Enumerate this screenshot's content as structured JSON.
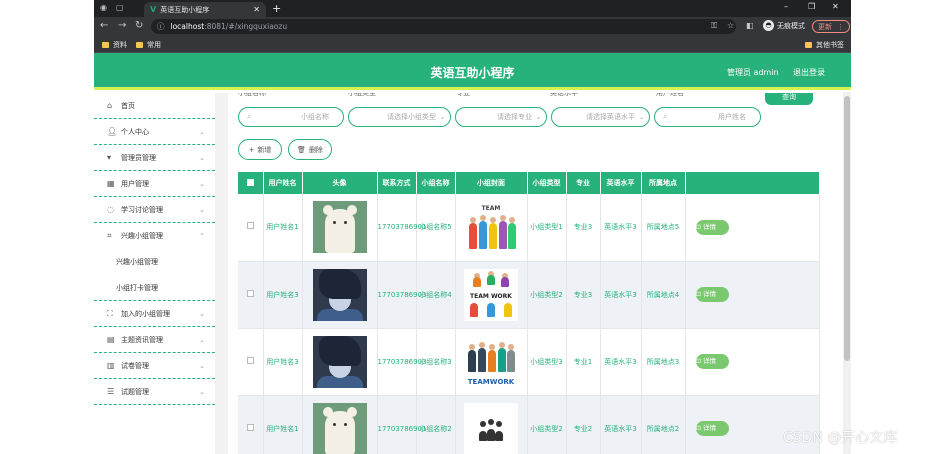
{
  "browser": {
    "tab_title": "英语互助小程序",
    "tab_favicon": "V",
    "url_host": "localhost",
    "url_path": ":8081/#/xingquxiaozu",
    "profile_label": "无痕模式",
    "update_label": "更新",
    "bookmarks": [
      "资料",
      "常用"
    ],
    "other_bookmarks": "其他书签"
  },
  "header": {
    "title": "英语互助小程序",
    "user": "管理员 admin",
    "logout": "退出登录"
  },
  "sidebar": {
    "items": [
      {
        "label": "首页",
        "icon": "home-icon"
      },
      {
        "label": "个人中心",
        "icon": "user-icon"
      },
      {
        "label": "管理员管理",
        "icon": "admin-icon"
      },
      {
        "label": "用户管理",
        "icon": "grid-icon"
      },
      {
        "label": "学习讨论管理",
        "icon": "loading-icon"
      },
      {
        "label": "兴趣小组管理",
        "icon": "crop-icon"
      },
      {
        "label": "加入的小组管理",
        "icon": "fullscreen-icon"
      },
      {
        "label": "主题资讯管理",
        "icon": "news-icon"
      },
      {
        "label": "试卷管理",
        "icon": "chart-icon"
      },
      {
        "label": "试题管理",
        "icon": "sliders-icon"
      }
    ],
    "subitems": [
      "兴趣小组管理",
      "小组打卡管理"
    ]
  },
  "search": {
    "labels": [
      "小组名称",
      "小组类型",
      "专业",
      "英语水平",
      "用户姓名"
    ],
    "placeholders": [
      "小组名称",
      "请选择小组类型",
      "请选择专业",
      "请选择英语水平",
      "用户姓名"
    ],
    "button": "查询"
  },
  "actions": {
    "add": "新增",
    "delete": "删除"
  },
  "table": {
    "columns": [
      "用户姓名",
      "头像",
      "联系方式",
      "小组名称",
      "小组封面",
      "小组类型",
      "专业",
      "英语水平",
      "所属地点"
    ],
    "detail_label": "详情",
    "rows": [
      {
        "user": "用户姓名1",
        "avatar": "bear",
        "phone": "17703786901",
        "group": "小组名称5",
        "cover": "team-hands",
        "type": "小组类型1",
        "major": "专业3",
        "level": "英语水平3",
        "place": "所属地点5"
      },
      {
        "user": "用户姓名3",
        "avatar": "anime-boy",
        "phone": "17703786903",
        "group": "小组名称4",
        "cover": "team-work",
        "type": "小组类型2",
        "major": "专业3",
        "level": "英语水平3",
        "place": "所属地点4"
      },
      {
        "user": "用户姓名3",
        "avatar": "anime-boy",
        "phone": "17703786903",
        "group": "小组名称3",
        "cover": "teamwork-office",
        "type": "小组类型3",
        "major": "专业1",
        "level": "英语水平3",
        "place": "所属地点3"
      },
      {
        "user": "用户姓名1",
        "avatar": "bear",
        "phone": "17703786901",
        "group": "小组名称2",
        "cover": "team-icon",
        "type": "小组类型2",
        "major": "专业2",
        "level": "英语水平3",
        "place": "所属地点2"
      }
    ]
  },
  "cover_text": {
    "team": "TEAM",
    "teamwork": "TEAM WORK",
    "teamwork_office": "TEAMWORK"
  },
  "watermark": "CSDN @开心文库",
  "colors": {
    "accent": "#27b17b",
    "header_underline": "#d7f24e",
    "detail_button": "#7bc96f"
  }
}
